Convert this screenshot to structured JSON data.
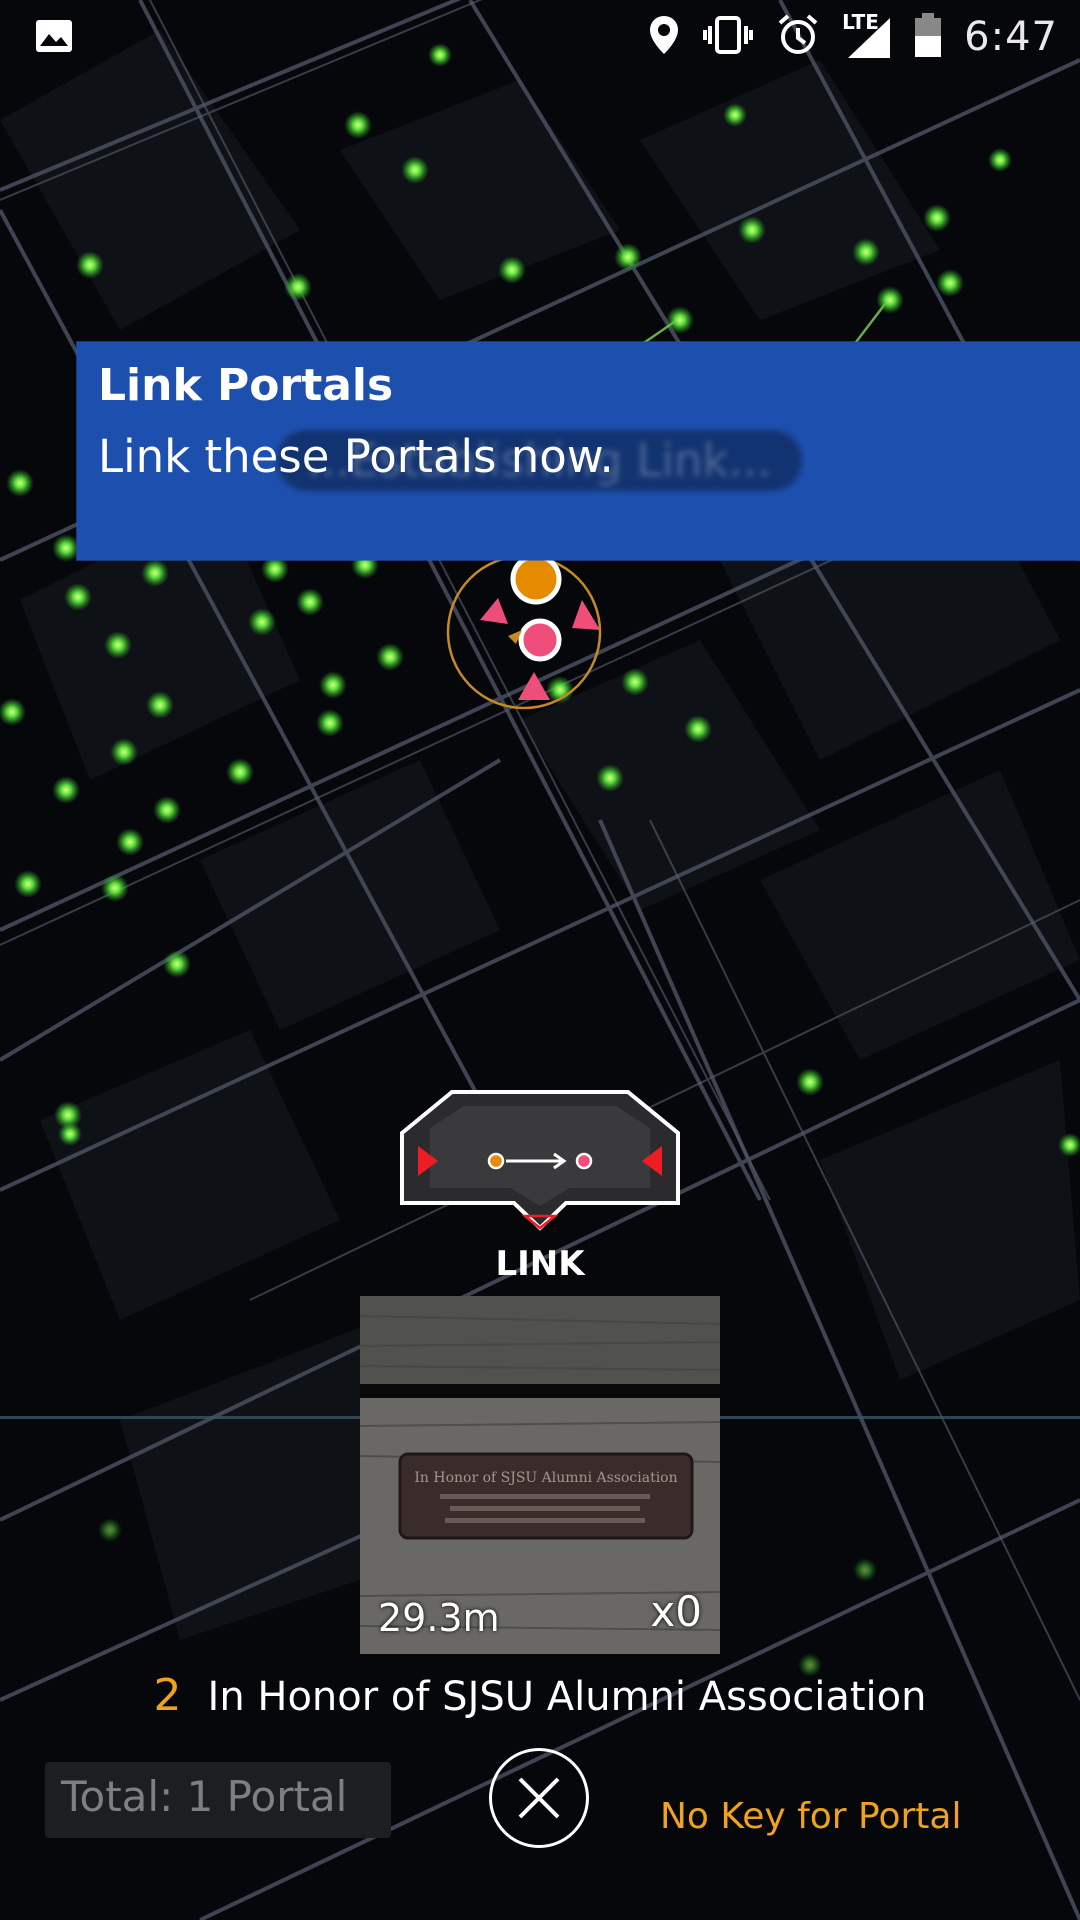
{
  "status_bar": {
    "time": "6:47",
    "network": "LTE",
    "icons": [
      "image-icon",
      "location-pin-icon",
      "vibrate-icon",
      "alarm-icon",
      "signal-icon",
      "battery-icon"
    ]
  },
  "banner": {
    "title": "Link Portals",
    "text": "Link these Portals now.",
    "ghost_text": "...Establishing Link..."
  },
  "link_control": {
    "label": "LINK",
    "icons": [
      "link-arrow-icon",
      "prev-portal-icon",
      "next-portal-icon",
      "expand-icon"
    ]
  },
  "portal": {
    "distance": "29.3m",
    "keys": "x0",
    "level": "2",
    "name": "In Honor of SJSU Alumni Association",
    "plaque_lines": [
      "In Honor of SJSU Alumni Association"
    ]
  },
  "footer": {
    "total": "Total: 1 Portal",
    "status": "No Key for Portal"
  },
  "colors": {
    "banner": "#1d4fae",
    "accent_orange": "#f0a21e",
    "portal_pink": "#ef4d7a",
    "portal_dot": "#8cff4a"
  }
}
